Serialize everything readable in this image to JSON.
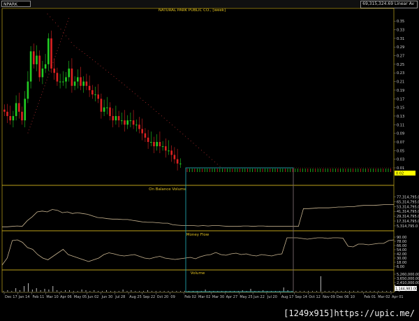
{
  "toolbar": {
    "symbol": "NPARK",
    "stats": [
      "69,315,324.69",
      "Linear",
      "Av"
    ]
  },
  "footer": {
    "text": "[1249x915]https://upic.me/"
  },
  "colors": {
    "up": "#22cc22",
    "down": "#dd2222",
    "panel_title": "#e0c020",
    "border": "#e0c020",
    "line": "#c8b490",
    "dots": "#c03030",
    "select_box": "#20a0a8",
    "highlight": "#ffff00"
  },
  "chart_data": [
    {
      "type": "candlestick",
      "title": "NATURAL PARK PUBLIC CO., [week]",
      "y_ticks": [
        "0.35",
        "0.33",
        "0.31",
        "0.29",
        "0.27",
        "0.25",
        "0.23",
        "0.21",
        "0.19",
        "0.17",
        "0.15",
        "0.13",
        "0.11",
        "0.09",
        "0.07",
        "0.05",
        "0.03",
        "0.01"
      ],
      "ylim": [
        0.01,
        0.36
      ],
      "last_value_label": "0.02",
      "x_tick_labels": [
        "Dec 17",
        "Jan 14",
        "Feb 11",
        "Mar 10",
        "Apr 06",
        "May 05",
        "Jun 02",
        "Jun 30",
        "Jul 28",
        "Aug 25",
        "Sep 22",
        "Oct 20",
        "09",
        "Feb 02",
        "Mar 02",
        "Mar 30",
        "Apr 27",
        "May 25",
        "Jun 22",
        "Jul 20",
        "Aug 17",
        "Sep 14",
        "Oct 12",
        "Nov 09",
        "Dec 06",
        "10",
        "Feb 01",
        "Mar 02",
        "Apr 01"
      ],
      "weekly_closes": [
        0.14,
        0.13,
        0.12,
        0.13,
        0.16,
        0.14,
        0.12,
        0.17,
        0.21,
        0.28,
        0.25,
        0.27,
        0.22,
        0.24,
        0.25,
        0.31,
        0.24,
        0.23,
        0.21,
        0.21,
        0.21,
        0.22,
        0.24,
        0.2,
        0.21,
        0.22,
        0.2,
        0.21,
        0.2,
        0.19,
        0.18,
        0.18,
        0.17,
        0.14,
        0.15,
        0.15,
        0.13,
        0.12,
        0.13,
        0.12,
        0.12,
        0.11,
        0.12,
        0.12,
        0.11,
        0.11,
        0.1,
        0.09,
        0.08,
        0.07,
        0.07,
        0.06,
        0.07,
        0.06,
        0.06,
        0.05,
        0.05,
        0.04,
        0.03,
        0.02,
        0.02
      ]
    },
    {
      "type": "line",
      "title": "On Balance Volume",
      "y_ticks": [
        "77,314,795.0",
        "65,314,795.0",
        "53,314,795.0",
        "41,314,795.0",
        "29,314,795.0",
        "17,314,795.0",
        "5,314,795.0"
      ],
      "ylim": [
        0,
        83314795
      ]
    },
    {
      "type": "line",
      "title": "Money Flow",
      "y_ticks": [
        "90.00",
        "78.00",
        "66.00",
        "54.00",
        "42.00",
        "30.00",
        "18.00",
        "6.00"
      ],
      "ylim": [
        0,
        100
      ]
    },
    {
      "type": "bar",
      "title": "Volume",
      "y_ticks": [
        "5,260,000.00",
        "3,650,000.00",
        "2,410,000.00",
        "1,144,983.00"
      ],
      "last_value_label": "1,144,983.00"
    }
  ]
}
